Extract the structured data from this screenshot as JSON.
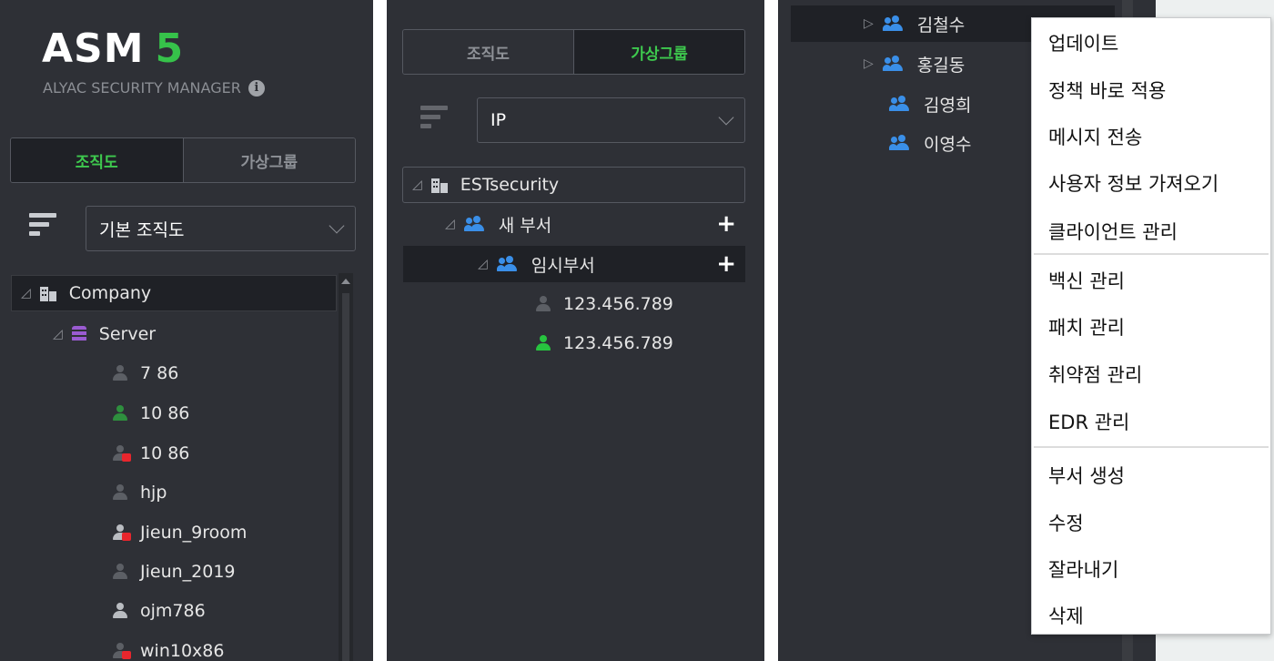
{
  "panel1": {
    "logo_main": "ASM",
    "logo_num": "5",
    "logo_sub": "ALYAC SECURITY MANAGER",
    "tabs": [
      "조직도",
      "가상그룹"
    ],
    "select_value": "기본 조직도",
    "tree": {
      "root": "Company",
      "server": "Server",
      "items": [
        "7 86",
        "10 86",
        "10 86",
        "hjp",
        "Jieun_9room",
        "Jieun_2019",
        "ojm786",
        "win10x86"
      ]
    }
  },
  "panel2": {
    "tabs": [
      "조직도",
      "가상그룹"
    ],
    "select_value": "IP",
    "tree": {
      "root": "ESTsecurity",
      "dept": "새 부서",
      "subdept": "임시부서",
      "ips": [
        "123.456.789",
        "123.456.789"
      ]
    }
  },
  "panel3": {
    "users": [
      "김철수",
      "홍길동",
      "김영희",
      "이영수"
    ]
  },
  "context_menu": {
    "group1": [
      "업데이트",
      "정책 바로 적용",
      "메시지 전송",
      "사용자 정보 가져오기",
      "클라이언트 관리"
    ],
    "group2": [
      "백신 관리",
      "패치 관리",
      "취약점 관리",
      "EDR 관리"
    ],
    "group3": [
      "부서 생성",
      "수정",
      "잘라내기",
      "삭제"
    ]
  },
  "colors": {
    "panel_bg": "#2e3036",
    "accent_green": "#3ec94e",
    "group_blue": "#3a8fe8",
    "alert_red": "#e8262d"
  }
}
